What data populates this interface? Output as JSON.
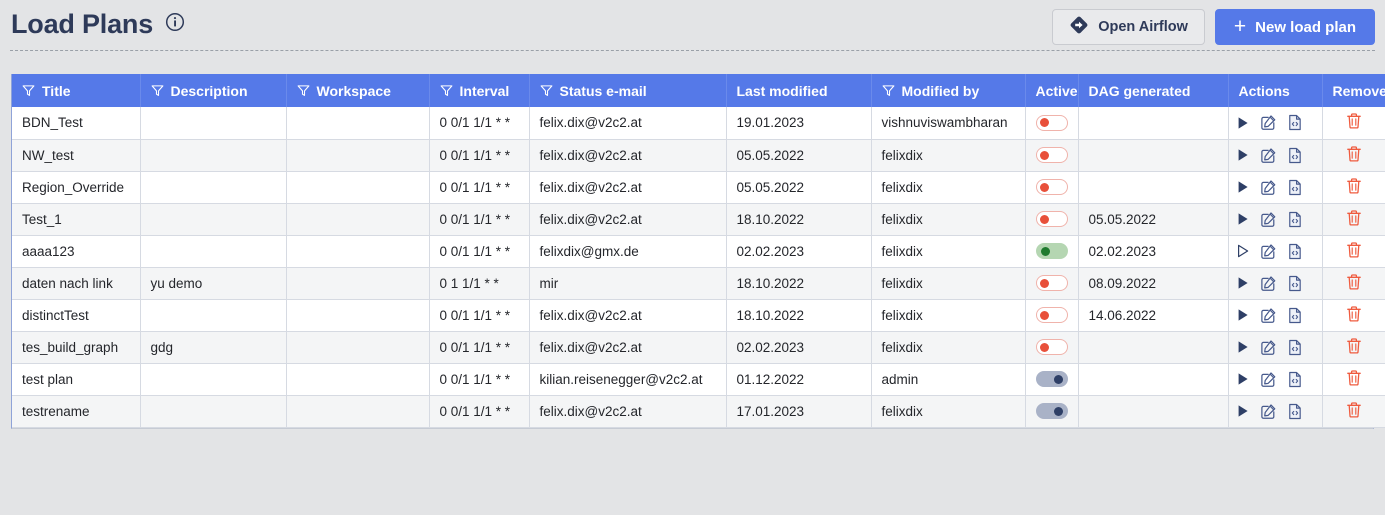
{
  "header": {
    "title": "Load Plans",
    "info_icon": "info-icon",
    "open_airflow_label": "Open Airflow",
    "airflow_icon": "airflow-logo-icon",
    "new_load_plan_label": "New load plan",
    "plus_icon": "plus-icon",
    "primary_color": "#5579e8",
    "title_color": "#2e3a59"
  },
  "table": {
    "columns": [
      {
        "label": "Title",
        "filter": true
      },
      {
        "label": "Description",
        "filter": true
      },
      {
        "label": "Workspace",
        "filter": true
      },
      {
        "label": "Interval",
        "filter": true
      },
      {
        "label": "Status e-mail",
        "filter": true
      },
      {
        "label": "Last modified",
        "filter": false
      },
      {
        "label": "Modified by",
        "filter": true
      },
      {
        "label": "Active",
        "filter": false
      },
      {
        "label": "DAG generated",
        "filter": false
      },
      {
        "label": "Actions",
        "filter": false
      },
      {
        "label": "Remove",
        "filter": false
      }
    ],
    "row_icons": {
      "run": "play-icon",
      "edit": "edit-icon",
      "code": "code-file-icon",
      "remove": "trash-icon"
    },
    "rows": [
      {
        "title": "BDN_Test",
        "description": "",
        "workspace": "",
        "interval": "0 0/1 1/1 * *",
        "status_email": "felix.dix@v2c2.at",
        "last_modified": "19.01.2023",
        "modified_by": "vishnuviswambharan",
        "active": "off",
        "dag_generated": "",
        "play": "filled"
      },
      {
        "title": "NW_test",
        "description": "",
        "workspace": "",
        "interval": "0 0/1 1/1 * *",
        "status_email": "felix.dix@v2c2.at",
        "last_modified": "05.05.2022",
        "modified_by": "felixdix",
        "active": "off",
        "dag_generated": "",
        "play": "filled"
      },
      {
        "title": "Region_Override",
        "description": "",
        "workspace": "",
        "interval": "0 0/1 1/1 * *",
        "status_email": "felix.dix@v2c2.at",
        "last_modified": "05.05.2022",
        "modified_by": "felixdix",
        "active": "off",
        "dag_generated": "",
        "play": "filled"
      },
      {
        "title": "Test_1",
        "description": "",
        "workspace": "",
        "interval": "0 0/1 1/1 * *",
        "status_email": "felix.dix@v2c2.at",
        "last_modified": "18.10.2022",
        "modified_by": "felixdix",
        "active": "off",
        "dag_generated": "05.05.2022",
        "play": "filled"
      },
      {
        "title": "aaaa123",
        "description": "",
        "workspace": "",
        "interval": "0 0/1 1/1 * *",
        "status_email": "felixdix@gmx.de",
        "last_modified": "02.02.2023",
        "modified_by": "felixdix",
        "active": "on",
        "dag_generated": "02.02.2023",
        "play": "outline"
      },
      {
        "title": "daten nach link",
        "description": "yu demo",
        "workspace": "",
        "interval": "0 1 1/1 * *",
        "status_email": "mir",
        "last_modified": "18.10.2022",
        "modified_by": "felixdix",
        "active": "off",
        "dag_generated": "08.09.2022",
        "play": "filled"
      },
      {
        "title": "distinctTest",
        "description": "",
        "workspace": "",
        "interval": "0 0/1 1/1 * *",
        "status_email": "felix.dix@v2c2.at",
        "last_modified": "18.10.2022",
        "modified_by": "felixdix",
        "active": "off",
        "dag_generated": "14.06.2022",
        "play": "filled"
      },
      {
        "title": "tes_build_graph",
        "description": "gdg",
        "workspace": "",
        "interval": "0 0/1 1/1 * *",
        "status_email": "felix.dix@v2c2.at",
        "last_modified": "02.02.2023",
        "modified_by": "felixdix",
        "active": "off",
        "dag_generated": "",
        "play": "filled"
      },
      {
        "title": "test plan",
        "description": "",
        "workspace": "",
        "interval": "0 0/1 1/1 * *",
        "status_email": "kilian.reisenegger@v2c2.at",
        "last_modified": "01.12.2022",
        "modified_by": "admin",
        "active": "blue",
        "dag_generated": "",
        "play": "filled"
      },
      {
        "title": "testrename",
        "description": "",
        "workspace": "",
        "interval": "0 0/1 1/1 * *",
        "status_email": "felix.dix@v2c2.at",
        "last_modified": "17.01.2023",
        "modified_by": "felixdix",
        "active": "blue",
        "dag_generated": "",
        "play": "filled"
      }
    ]
  }
}
